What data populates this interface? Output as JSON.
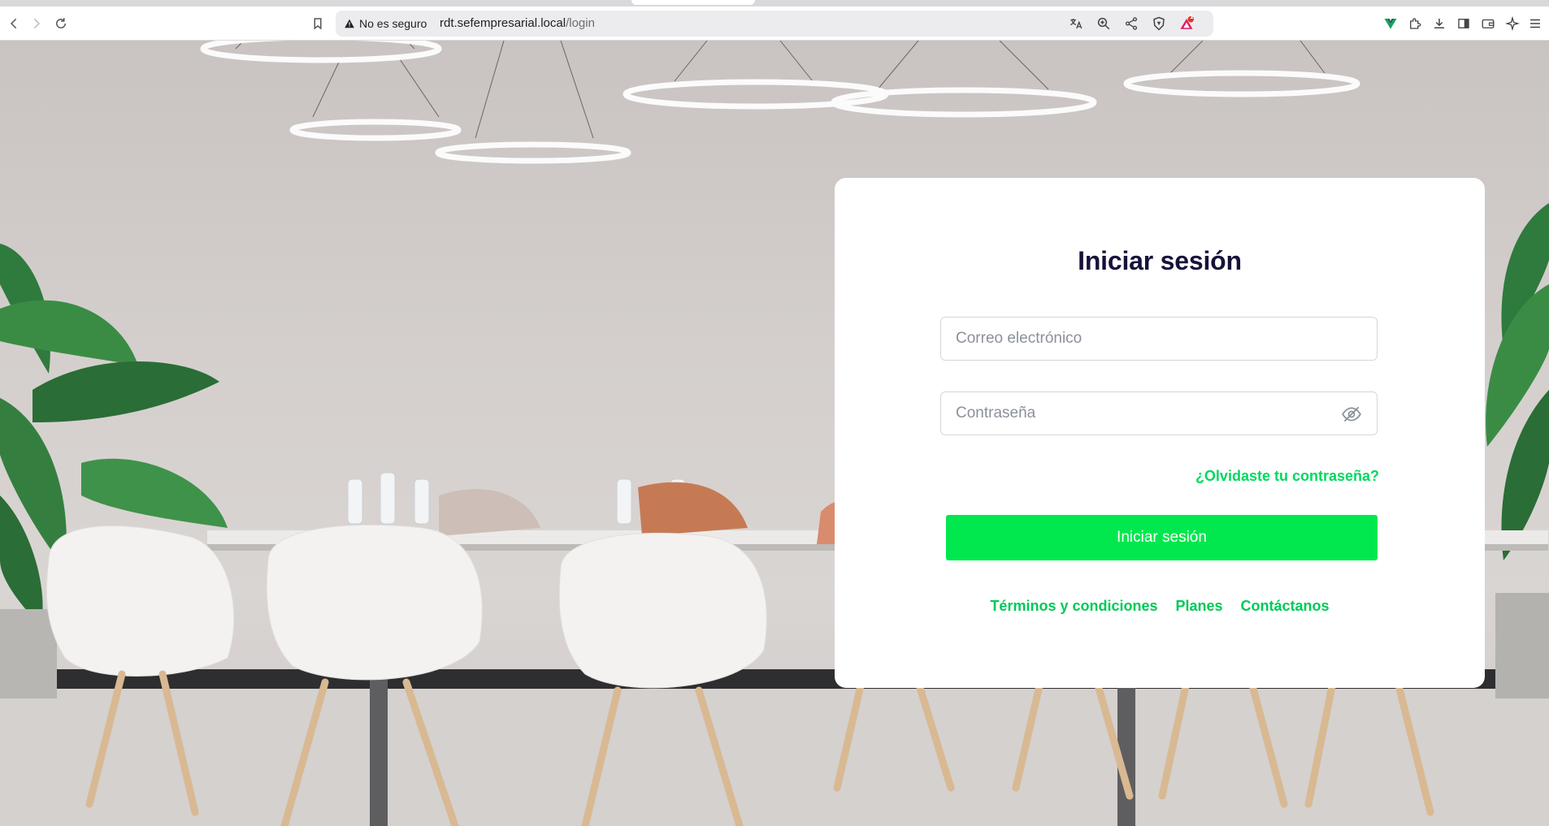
{
  "browser": {
    "security_label": "No es seguro",
    "url_host": "rdt.sefempresarial.local",
    "url_path": "/login",
    "notification_count": "1"
  },
  "login": {
    "title": "Iniciar sesión",
    "email_placeholder": "Correo electrónico",
    "password_placeholder": "Contraseña",
    "forgot_label": "¿Olvidaste tu contraseña?",
    "submit_label": "Iniciar sesión",
    "footer_links": [
      "Términos y condiciones",
      "Planes",
      "Contáctanos"
    ]
  },
  "colors": {
    "accent": "#00e84d",
    "link": "#00c957",
    "title": "#16123a"
  }
}
